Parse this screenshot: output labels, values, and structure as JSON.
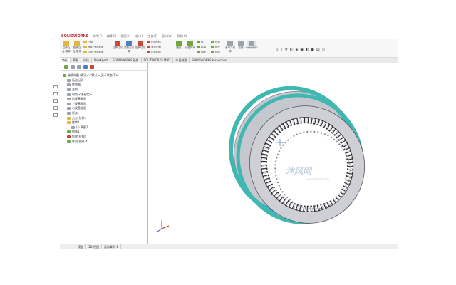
{
  "app": {
    "logo": "SOLIDWORKS",
    "menu": [
      "文件(F)",
      "编辑(E)",
      "视图(V)",
      "插入(I)",
      "工具(T)",
      "窗口(W)",
      "帮助(H)"
    ]
  },
  "ribbon": {
    "big_buttons": [
      {
        "label": "拉伸凸台/基体",
        "color": "#e3b73a"
      },
      {
        "label": "旋转凸台/基体",
        "color": "#e3b73a"
      },
      {
        "label": "拉伸切除",
        "color": "#c9473c"
      },
      {
        "label": "异型孔向导",
        "color": "#4d7fc1"
      },
      {
        "label": "旋转切除",
        "color": "#c9473c"
      },
      {
        "label": "圆角",
        "color": "#6fa83d"
      },
      {
        "label": "线性阵列",
        "color": "#6fa83d"
      },
      {
        "label": "参考几何体",
        "color": "#9aa3ad"
      },
      {
        "label": "曲线",
        "color": "#9aa3ad"
      },
      {
        "label": "Instant3D",
        "color": "#9aa3ad"
      }
    ],
    "small_items": [
      "扫描",
      "放样凸台/基体",
      "边界凸台/基体",
      "扫描切除",
      "放样切割",
      "边界切除",
      "筋",
      "拔模",
      "抽壳",
      "包覆",
      "相交",
      "镜向"
    ]
  },
  "tabs": [
    "特征",
    "草图",
    "评估",
    "DimXpert",
    "SOLIDWORKS 插件",
    "SOLIDWORKS MBD",
    "今日制造",
    "SOLIDWORKS Inspection"
  ],
  "tree": {
    "nodes": [
      {
        "label": "轴承外圈  (默认<<默认>_显示状态 1>)",
        "indent": 0,
        "color": "#6fa83d"
      },
      {
        "label": "历史记录",
        "indent": 1,
        "color": "#9aa3ad"
      },
      {
        "label": "传感器",
        "indent": 1,
        "color": "#9aa3ad"
      },
      {
        "label": "注解",
        "indent": 1,
        "color": "#9aa3ad"
      },
      {
        "label": "材质 <未指定>",
        "indent": 1,
        "color": "#9aa3ad"
      },
      {
        "label": "前视基准面",
        "indent": 1,
        "color": "#9aa3ad"
      },
      {
        "label": "上视基准面",
        "indent": 1,
        "color": "#9aa3ad"
      },
      {
        "label": "右视基准面",
        "indent": 1,
        "color": "#9aa3ad"
      },
      {
        "label": "原点",
        "indent": 1,
        "color": "#9aa3ad"
      },
      {
        "label": "凸台-拉伸1",
        "indent": 1,
        "color": "#e3b73a"
      },
      {
        "label": "旋转1",
        "indent": 1,
        "color": "#e3b73a"
      },
      {
        "label": "(-) 草图1",
        "indent": 2,
        "color": "#9aa3ad"
      },
      {
        "label": "倒角1",
        "indent": 1,
        "color": "#6fa83d"
      },
      {
        "label": "切除-拉伸2",
        "indent": 1,
        "color": "#c9473c"
      },
      {
        "label": "阵列(圆周)4",
        "indent": 1,
        "color": "#6fa83d"
      }
    ]
  },
  "viewport": {
    "watermark": "沐风网",
    "watermark_sub": "www.mfcad.com"
  },
  "bottom_tabs": [
    "",
    "模型",
    "3D 视图",
    "运动算例 1"
  ]
}
